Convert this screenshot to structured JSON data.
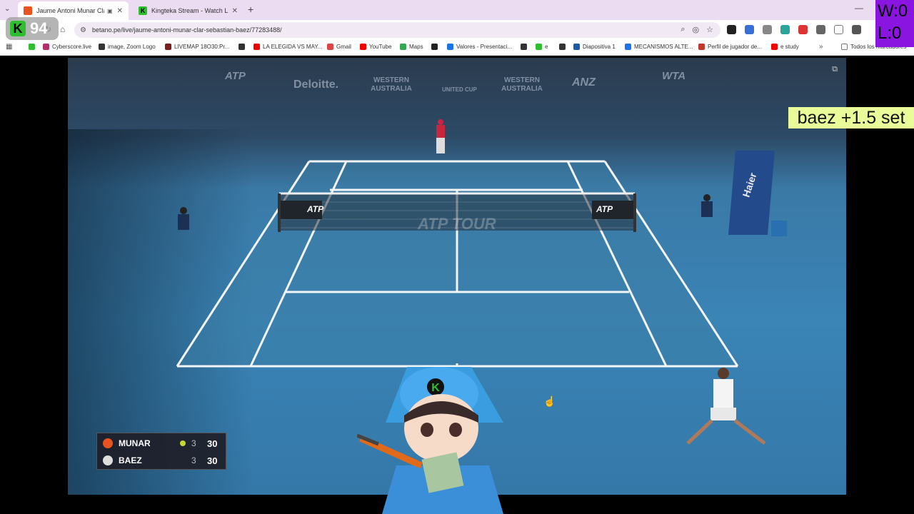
{
  "browser": {
    "tabs": [
      {
        "title": "Jaume Antoni Munar Clar -",
        "active": true,
        "favicon": "betano-icon"
      },
      {
        "title": "Kingteka Stream - Watch Live o",
        "active": false,
        "favicon": "kick-icon"
      }
    ],
    "url": "betano.pe/live/jaume-antoni-munar-clar-sebastian-baez/77283488/",
    "bookmarks": [
      "Cyberscore.live",
      "image, Zoom Logo",
      "LIVEMAP 18O30:Pr...",
      "LA ELEGIDA VS MAY...",
      "Gmail",
      "YouTube",
      "Maps",
      "Valores - Presentaci...",
      "e",
      "Diapositiva 1",
      "MECANISMOS ALTE...",
      "Perfil de jugador de...",
      "e study"
    ],
    "all_bookmarks": "Todos los marcadores"
  },
  "video": {
    "sponsors": [
      "ATP",
      "Deloitte.",
      "WESTERN AUSTRALIA",
      "UNITED CUP",
      "WESTERN AUSTRALIA",
      "ANZ",
      "WTA"
    ],
    "net_text": "ATP TOUR",
    "net_logo": "ATP",
    "chair_brand": "Haier"
  },
  "scoreboard": {
    "players": [
      {
        "name": "MUNAR",
        "games": "3",
        "points": "30",
        "serving": true
      },
      {
        "name": "BAEZ",
        "games": "3",
        "points": "30",
        "serving": false
      }
    ]
  },
  "overlay": {
    "viewer_count": "94",
    "kick_logo": "K",
    "wins_label": "W:0",
    "losses_label": "L:0",
    "bet_label": "baez +1.5 set"
  },
  "colors": {
    "court": "#3a84b6",
    "bet_label_bg": "#eafc9a",
    "wl_bg": "#8a15e0",
    "kick_green": "#2dbf2f"
  }
}
